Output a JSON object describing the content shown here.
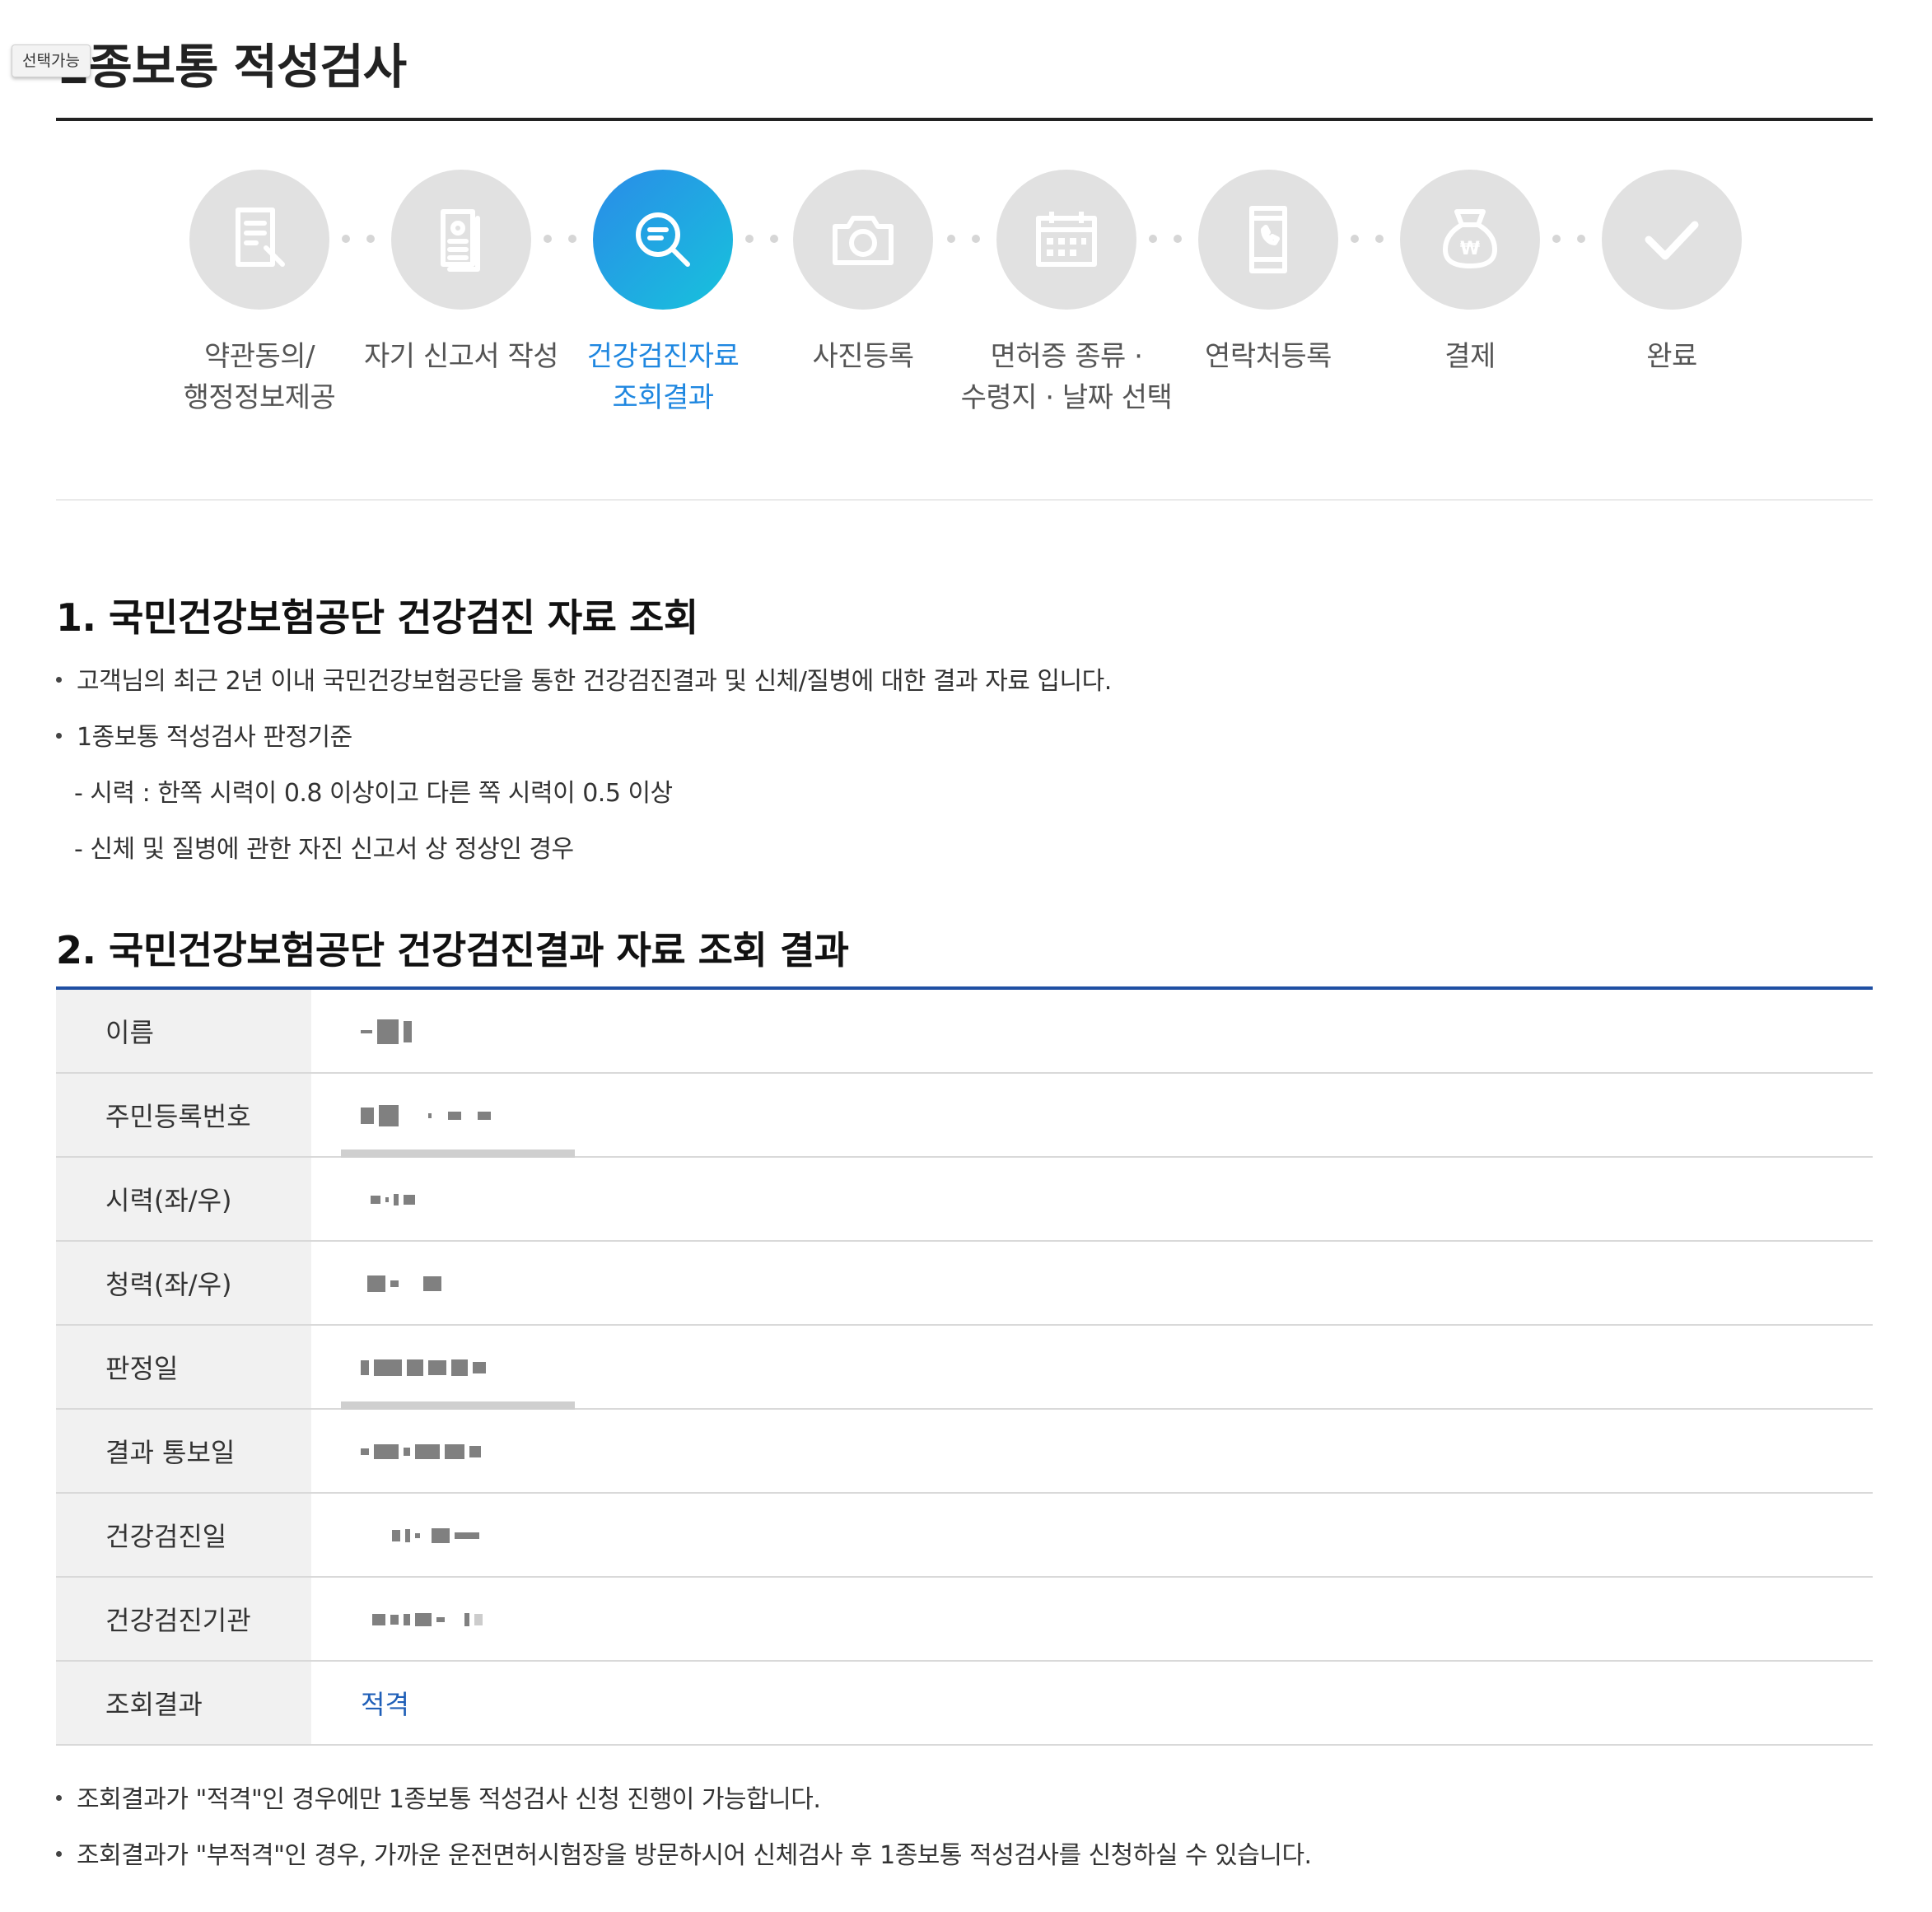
{
  "tooltip": "선택가능",
  "page_title": "1종보통 적성검사",
  "steps": [
    {
      "label": "약관동의/\n행정정보제공",
      "icon": "document-edit-icon",
      "active": false
    },
    {
      "label": "자기 신고서 작성",
      "icon": "profile-document-icon",
      "active": false
    },
    {
      "label": "건강검진자료\n조회결과",
      "icon": "search-document-icon",
      "active": true
    },
    {
      "label": "사진등록",
      "icon": "camera-icon",
      "active": false
    },
    {
      "label": "면허증 종류 ·\n수령지 · 날짜 선택",
      "icon": "calendar-icon",
      "active": false
    },
    {
      "label": "연락처등록",
      "icon": "phone-icon",
      "active": false
    },
    {
      "label": "결제",
      "icon": "won-bag-icon",
      "active": false
    },
    {
      "label": "완료",
      "icon": "check-icon",
      "active": false
    }
  ],
  "section1": {
    "title": "1. 국민건강보험공단 건강검진 자료 조회",
    "bullet1": "고객님의 최근 2년 이내 국민건강보험공단을 통한 건강검진결과 및 신체/질병에 대한 결과 자료 입니다.",
    "bullet2": "1종보통 적성검사 판정기준",
    "sub1": "- 시력 : 한쪽 시력이 0.8 이상이고 다른 쪽 시력이 0.5 이상",
    "sub2": "- 신체 및 질병에 관한 자진 신고서 상 정상인 경우"
  },
  "section2": {
    "title": "2. 국민건강보험공단 건강검진결과 자료 조회 결과",
    "rows": [
      {
        "label": "이름"
      },
      {
        "label": "주민등록번호"
      },
      {
        "label": "시력(좌/우)"
      },
      {
        "label": "청력(좌/우)"
      },
      {
        "label": "판정일"
      },
      {
        "label": "결과 통보일"
      },
      {
        "label": "건강검진일"
      },
      {
        "label": "건강검진기관"
      },
      {
        "label": "조회결과",
        "value": "적격"
      }
    ]
  },
  "notes": [
    "조회결과가 \"적격\"인 경우에만 1종보통 적성검사 신청 진행이 가능합니다.",
    "조회결과가 \"부적격\"인 경우, 가까운 운전면허시험장을 방문하시어 신체검사 후 1종보통 적성검사를 신청하실 수 있습니다."
  ],
  "colors": {
    "accent": "#1f87e0",
    "table_top": "#1f4fa3",
    "pass": "#1f5fb8"
  }
}
